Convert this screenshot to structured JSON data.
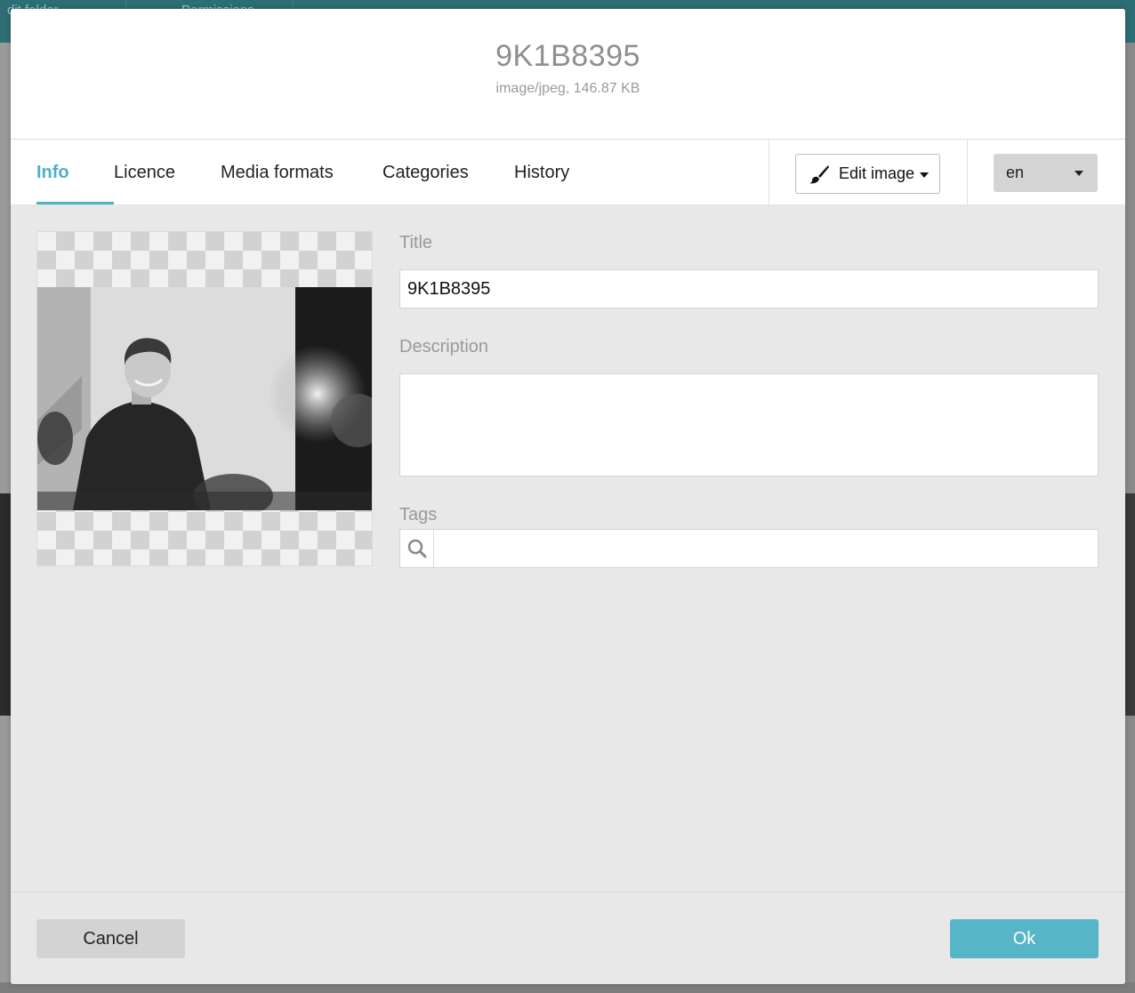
{
  "background": {
    "tabs": [
      "dit folder",
      "Permissions"
    ]
  },
  "dialog": {
    "title": "9K1B8395",
    "subtitle": "image/jpeg, 146.87 KB"
  },
  "tabs": [
    {
      "label": "Info",
      "active": true
    },
    {
      "label": "Licence",
      "active": false
    },
    {
      "label": "Media formats",
      "active": false
    },
    {
      "label": "Categories",
      "active": false
    },
    {
      "label": "History",
      "active": false
    }
  ],
  "toolbar": {
    "edit_image_label": "Edit image",
    "edit_image_icon": "brush-icon",
    "language_value": "en"
  },
  "form": {
    "title_label": "Title",
    "title_value": "9K1B8395",
    "description_label": "Description",
    "description_value": "",
    "tags_label": "Tags",
    "tags_value": ""
  },
  "footer": {
    "cancel_label": "Cancel",
    "ok_label": "Ok"
  },
  "colors": {
    "accent": "#4fb1c6",
    "ok_button": "#57b5c8",
    "cancel_button": "#d3d3d3"
  }
}
